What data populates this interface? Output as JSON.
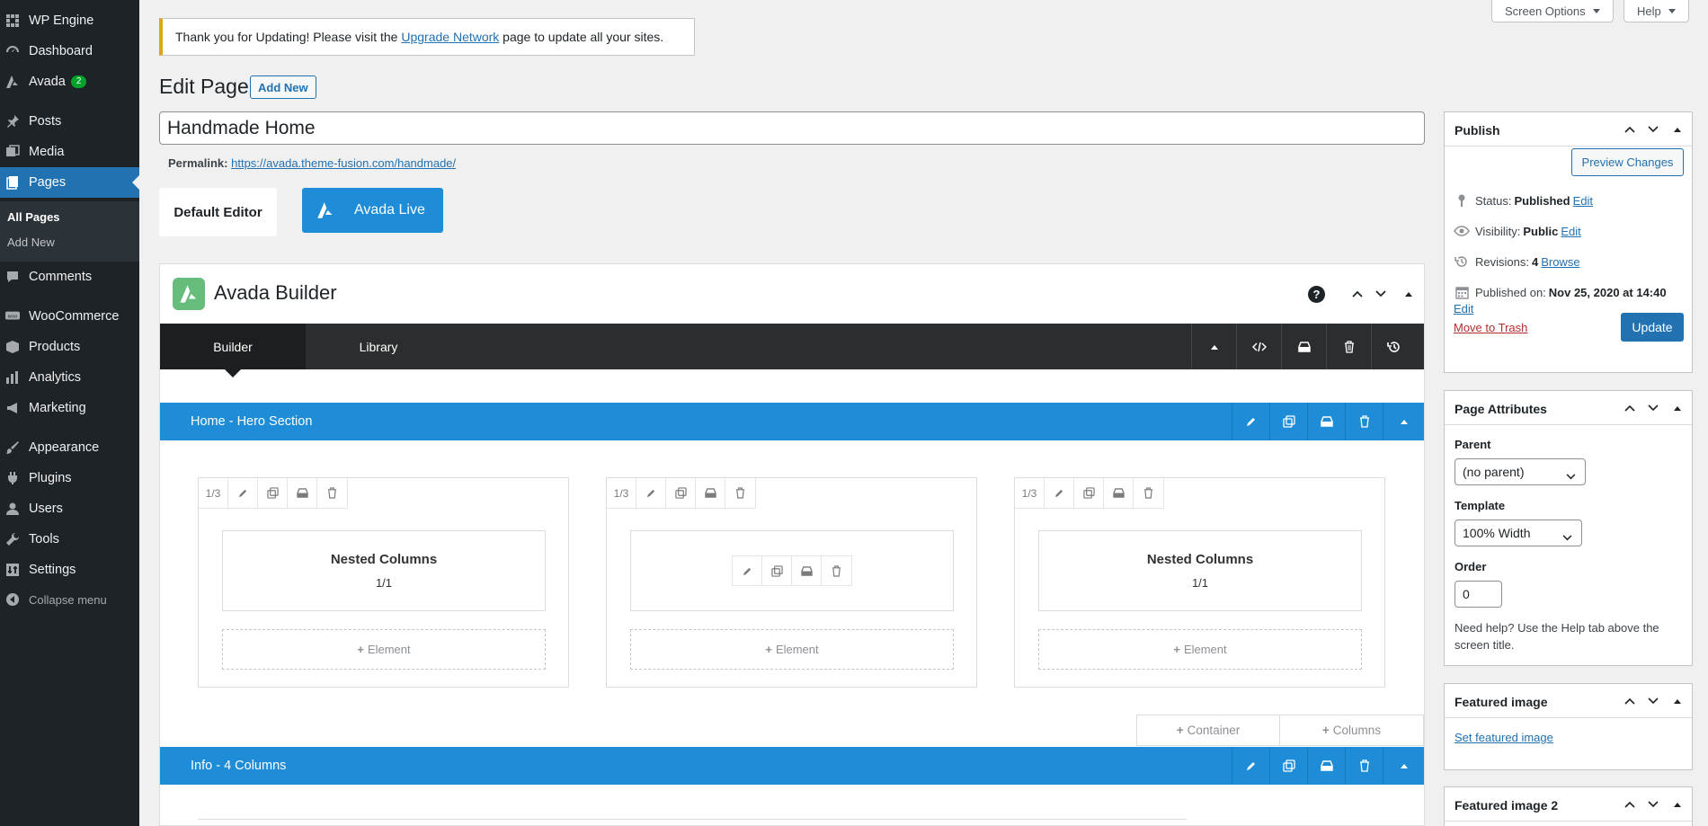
{
  "sidebar": {
    "items": [
      {
        "label": "WP Engine",
        "icon": "wp-engine-icon"
      },
      {
        "label": "Dashboard",
        "icon": "dashboard-icon"
      },
      {
        "label": "Avada",
        "icon": "avada-icon",
        "badge": "2"
      },
      {
        "label": "Posts",
        "icon": "pin-icon"
      },
      {
        "label": "Media",
        "icon": "media-icon"
      },
      {
        "label": "Pages",
        "icon": "pages-icon"
      },
      {
        "label": "Comments",
        "icon": "comment-icon"
      },
      {
        "label": "WooCommerce",
        "icon": "woo-icon"
      },
      {
        "label": "Products",
        "icon": "products-icon"
      },
      {
        "label": "Analytics",
        "icon": "analytics-icon"
      },
      {
        "label": "Marketing",
        "icon": "marketing-icon"
      },
      {
        "label": "Appearance",
        "icon": "brush-icon"
      },
      {
        "label": "Plugins",
        "icon": "plugin-icon"
      },
      {
        "label": "Users",
        "icon": "user-icon"
      },
      {
        "label": "Tools",
        "icon": "wrench-icon"
      },
      {
        "label": "Settings",
        "icon": "settings-icon"
      }
    ],
    "submenu": [
      "All Pages",
      "Add New"
    ],
    "collapse": "Collapse menu"
  },
  "top_buttons": {
    "screen_options": "Screen Options",
    "help": "Help"
  },
  "notice": {
    "before": "Thank you for Updating! Please visit the ",
    "link": "Upgrade Network",
    "after": " page to update all your sites."
  },
  "page_title": "Edit Page",
  "add_new": "Add New",
  "title_value": "Handmade Home",
  "permalink": {
    "label": "Permalink:",
    "url": "https://avada.theme-fusion.com/handmade/"
  },
  "editor_buttons": {
    "default": "Default Editor",
    "live": "Avada Live"
  },
  "builder": {
    "title": "Avada Builder",
    "help": "?",
    "tabs": [
      "Builder",
      "Library"
    ],
    "sections": [
      {
        "label": "Home - Hero Section"
      },
      {
        "label": "Info - 4 Columns"
      }
    ],
    "columns": [
      {
        "size": "1/3",
        "nested": true,
        "nested_title": "Nested Columns",
        "nested_sub": "1/1"
      },
      {
        "size": "1/3",
        "nested": false
      },
      {
        "size": "1/3",
        "nested": true,
        "nested_title": "Nested Columns",
        "nested_sub": "1/1"
      }
    ],
    "add_element": "Element",
    "add_container": "Container",
    "add_columns": "Columns"
  },
  "publish": {
    "title": "Publish",
    "preview": "Preview Changes",
    "status_label": "Status:",
    "status_value": "Published",
    "status_edit": "Edit",
    "visibility_label": "Visibility:",
    "visibility_value": "Public",
    "visibility_edit": "Edit",
    "revisions_label": "Revisions:",
    "revisions_value": "4",
    "revisions_browse": "Browse",
    "published_label": "Published on:",
    "published_value": "Nov 25, 2020 at 14:40",
    "published_edit": "Edit",
    "trash": "Move to Trash",
    "update": "Update"
  },
  "page_attributes": {
    "title": "Page Attributes",
    "parent_label": "Parent",
    "parent_value": "(no parent)",
    "template_label": "Template",
    "template_value": "100% Width",
    "order_label": "Order",
    "order_value": "0",
    "help": "Need help? Use the Help tab above the screen title."
  },
  "featured_image": {
    "title": "Featured image",
    "link": "Set featured image"
  },
  "featured_image_2": {
    "title": "Featured image 2"
  },
  "colors": {
    "sidebar": "#1d2327",
    "accent": "#2271b1",
    "avada_blue": "#1e8cd6",
    "avada_green": "#65bc7b"
  }
}
